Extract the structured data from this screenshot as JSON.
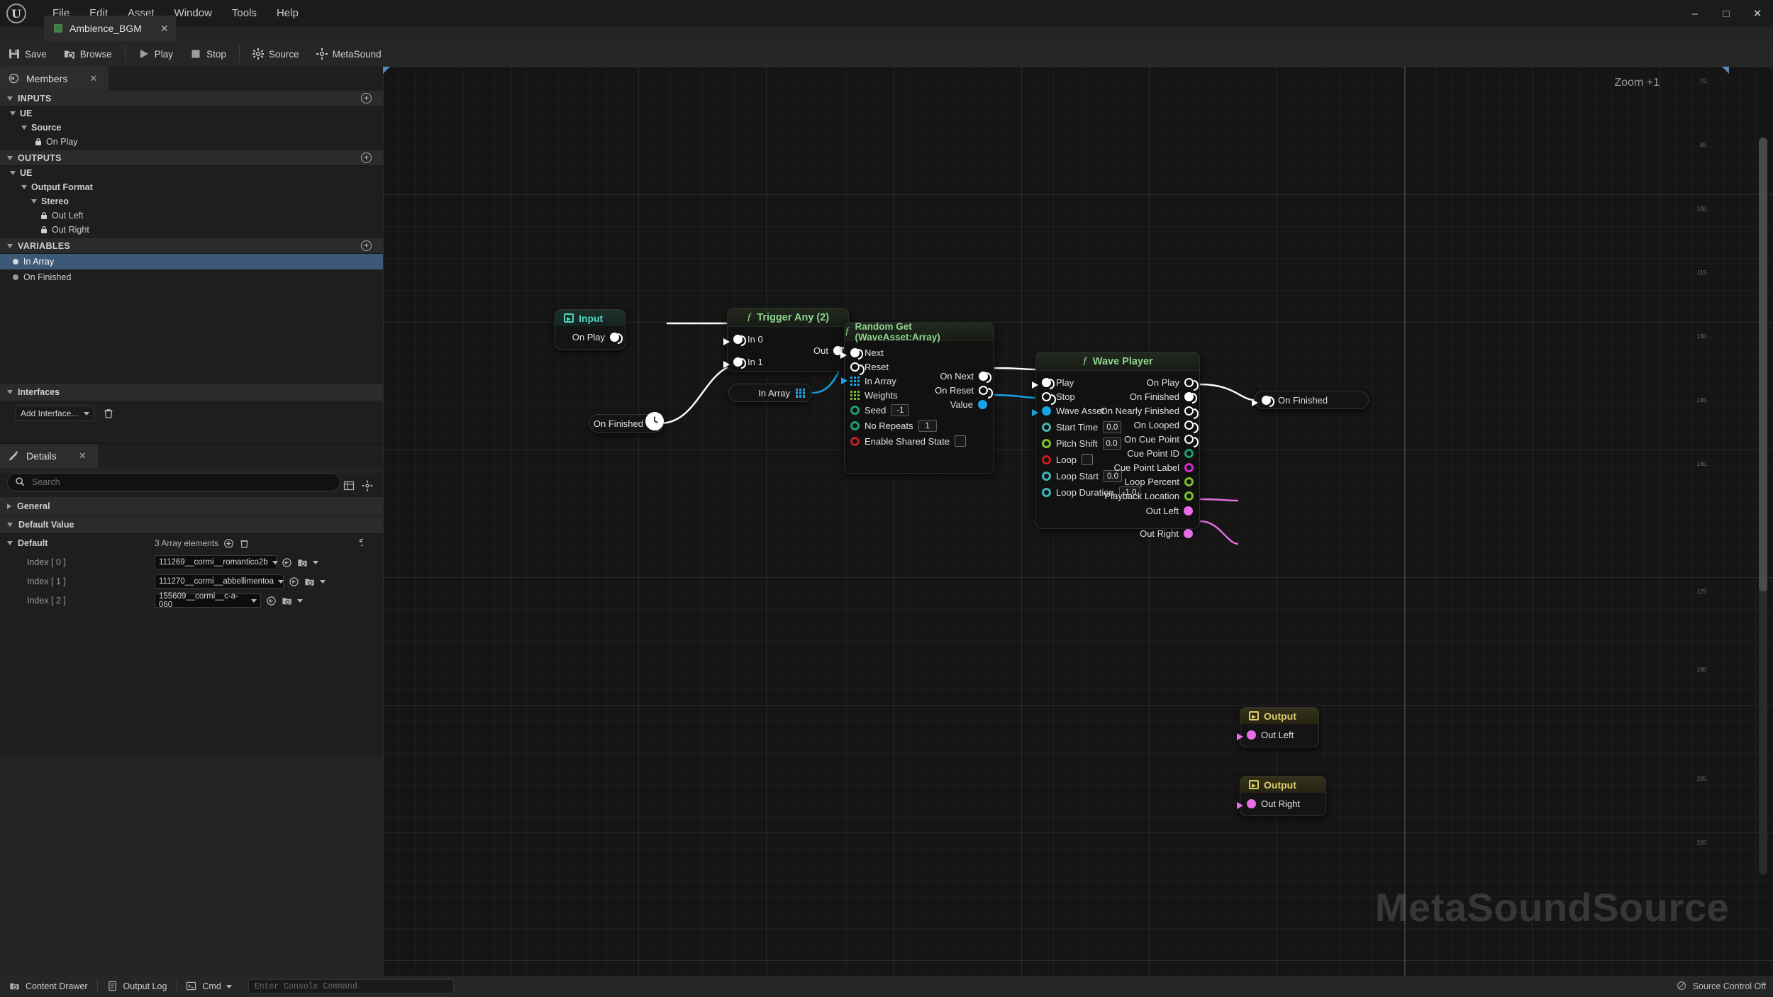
{
  "window": {
    "menus": [
      "File",
      "Edit",
      "Asset",
      "Window",
      "Tools",
      "Help"
    ],
    "controls": {
      "minimize": "–",
      "maximize": "□",
      "close": "✕"
    }
  },
  "asset_tab": {
    "label": "Ambience_BGM",
    "close": "✕"
  },
  "toolbar": {
    "items": [
      {
        "label": "Save",
        "icon": "save-icon"
      },
      {
        "label": "Browse",
        "icon": "browse-icon"
      },
      {
        "label": "Play",
        "icon": "play-icon"
      },
      {
        "label": "Stop",
        "icon": "stop-icon"
      },
      {
        "label": "Source",
        "icon": "gear-icon"
      },
      {
        "label": "MetaSound",
        "icon": "metasound-icon"
      }
    ]
  },
  "members_panel": {
    "tab_label": "Members",
    "tab_close": "✕",
    "sections": [
      {
        "title": "INPUTS",
        "add": "+",
        "rows": [
          {
            "label": "UE",
            "indent": 1,
            "kind": "group"
          },
          {
            "label": "Source",
            "indent": 2,
            "kind": "group"
          },
          {
            "label": "On Play",
            "indent": 3,
            "kind": "locked"
          }
        ]
      },
      {
        "title": "OUTPUTS",
        "add": "+",
        "rows": [
          {
            "label": "UE",
            "indent": 1,
            "kind": "group"
          },
          {
            "label": "Output Format",
            "indent": 2,
            "kind": "group"
          },
          {
            "label": "Stereo",
            "indent": 3,
            "kind": "group"
          },
          {
            "label": "Out Left",
            "indent": 4,
            "kind": "locked"
          },
          {
            "label": "Out Right",
            "indent": 4,
            "kind": "locked"
          }
        ]
      },
      {
        "title": "VARIABLES",
        "add": "+",
        "rows": [
          {
            "label": "In Array",
            "indent": 1,
            "kind": "variable",
            "selected": true
          },
          {
            "label": "On Finished",
            "indent": 1,
            "kind": "variable",
            "selected": false
          }
        ]
      }
    ]
  },
  "interfaces_panel": {
    "title": "Interfaces",
    "add_interface_label": "Add Interface...",
    "delete_icon": "trash-icon"
  },
  "details_panel": {
    "tab_label": "Details",
    "tab_close": "✕",
    "search_placeholder": "Search",
    "toolbar_icons": [
      "grid-view-icon",
      "settings-icon"
    ],
    "sections": [
      {
        "title": "General",
        "expanded": false
      },
      {
        "title": "Default Value",
        "expanded": true
      }
    ],
    "default_row": {
      "label": "Default",
      "summary": "3 Array elements",
      "add_icon": "+",
      "delete_icon": "trash-icon",
      "reset_icon": "reset-arrow-icon"
    },
    "array_items": [
      {
        "index_label": "Index [ 0 ]",
        "value": "111269__cormi__romantico2b"
      },
      {
        "index_label": "Index [ 1 ]",
        "value": "111270__cormi__abbellimentoa"
      },
      {
        "index_label": "Index [ 2 ]",
        "value": "155609__cormi__c-a-060"
      }
    ]
  },
  "graph": {
    "zoom_label": "Zoom +1",
    "watermark": "MetaSoundSource",
    "ruler_ticks": [
      "70",
      "85",
      "100",
      "115",
      "130",
      "145",
      "160",
      "175",
      "190",
      "205",
      "220"
    ],
    "nodes": [
      {
        "id": "input-on-play",
        "type": "input",
        "title": "Input",
        "outputs": [
          {
            "label": "On Play",
            "pin": "trigger"
          }
        ]
      },
      {
        "id": "trigger-any",
        "type": "function",
        "title": "Trigger Any (2)",
        "inputs": [
          {
            "label": "In 0",
            "pin": "trigger"
          },
          {
            "label": "In 1",
            "pin": "trigger"
          }
        ],
        "outputs": [
          {
            "label": "Out",
            "pin": "trigger"
          }
        ]
      },
      {
        "id": "random-get",
        "type": "function",
        "title": "Random Get (WaveAsset:Array)",
        "inputs": [
          {
            "label": "Next",
            "pin": "trigger"
          },
          {
            "label": "Reset",
            "pin": "trigger-hollow"
          },
          {
            "label": "In Array",
            "pin": "array-blue"
          },
          {
            "label": "Weights",
            "pin": "array-green"
          },
          {
            "label": "Seed",
            "pin": "ring-green",
            "value": "-1"
          },
          {
            "label": "No Repeats",
            "pin": "ring-green",
            "value": "1"
          },
          {
            "label": "Enable Shared State",
            "pin": "ring-red",
            "value": "",
            "checkbox": true
          }
        ],
        "outputs": [
          {
            "label": "On Next",
            "pin": "trigger"
          },
          {
            "label": "On Reset",
            "pin": "trigger-hollow"
          },
          {
            "label": "Value",
            "pin": "dot-blue"
          }
        ]
      },
      {
        "id": "wave-player",
        "type": "function",
        "title": "Wave Player",
        "inputs": [
          {
            "label": "Play",
            "pin": "trigger"
          },
          {
            "label": "Stop",
            "pin": "trigger-hollow"
          },
          {
            "label": "Wave Asset",
            "pin": "dot-blue"
          },
          {
            "label": "Start Time",
            "pin": "ring-teal",
            "value": "0.0"
          },
          {
            "label": "Pitch Shift",
            "pin": "ring-lime",
            "value": "0.0"
          },
          {
            "label": "Loop",
            "pin": "ring-red",
            "checkbox": true
          },
          {
            "label": "Loop Start",
            "pin": "ring-teal",
            "value": "0.0"
          },
          {
            "label": "Loop Duration",
            "pin": "ring-teal",
            "value": "-1.0"
          }
        ],
        "outputs": [
          {
            "label": "On Play",
            "pin": "trigger-hollow"
          },
          {
            "label": "On Finished",
            "pin": "trigger"
          },
          {
            "label": "On Nearly Finished",
            "pin": "trigger-hollow"
          },
          {
            "label": "On Looped",
            "pin": "trigger-hollow"
          },
          {
            "label": "On Cue Point",
            "pin": "trigger-hollow"
          },
          {
            "label": "Cue Point ID",
            "pin": "ring-green"
          },
          {
            "label": "Cue Point Label",
            "pin": "ring-mag"
          },
          {
            "label": "Loop Percent",
            "pin": "ring-lime"
          },
          {
            "label": "Playback Location",
            "pin": "ring-lime"
          },
          {
            "label": "Out Left",
            "pin": "dot-pink"
          },
          {
            "label": "Out Right",
            "pin": "dot-pink"
          }
        ]
      },
      {
        "id": "var-on-finished",
        "type": "pill",
        "label": "On Finished",
        "pin": "trigger"
      },
      {
        "id": "var-in-array",
        "type": "pill",
        "label": "In Array",
        "pin": "array-blue"
      },
      {
        "id": "out-on-finished",
        "type": "pill",
        "label": "On Finished",
        "pin": "trigger"
      },
      {
        "id": "output-out-left",
        "type": "output",
        "title": "Output",
        "label": "Out Left",
        "pin": "dot-pink"
      },
      {
        "id": "output-out-right",
        "type": "output",
        "title": "Output",
        "label": "Out Right",
        "pin": "dot-pink"
      }
    ]
  },
  "statusbar": {
    "content_drawer": "Content Drawer",
    "output_log": "Output Log",
    "cmd": "Cmd",
    "console_placeholder": "Enter Console Command",
    "source_control": "Source Control Off"
  }
}
